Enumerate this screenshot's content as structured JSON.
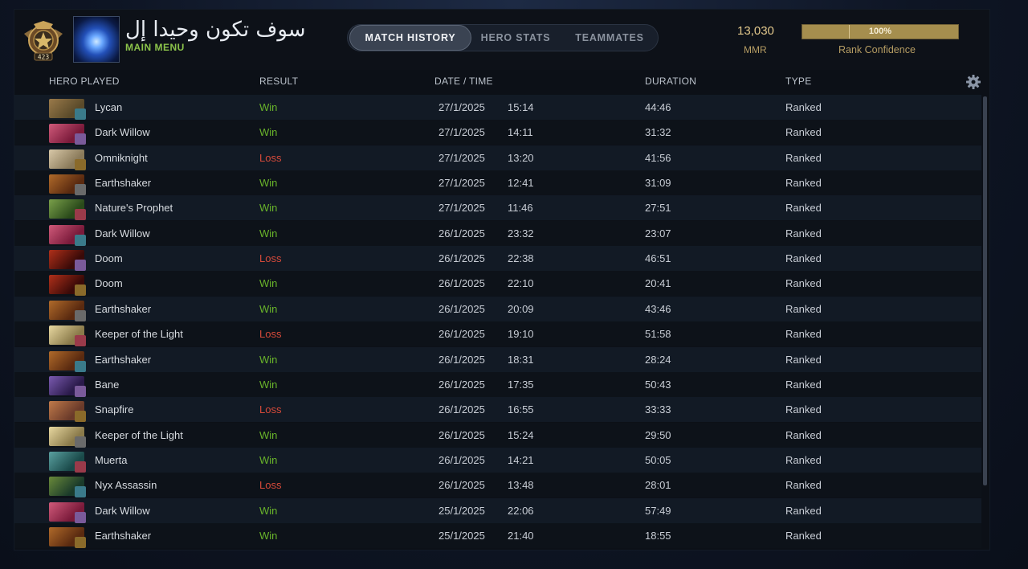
{
  "header": {
    "player_name": "سوف تكون وحيدا إل",
    "main_menu": "MAIN MENU",
    "rank_number": "423",
    "tabs": [
      {
        "label": "MATCH HISTORY",
        "active": true
      },
      {
        "label": "HERO STATS",
        "active": false
      },
      {
        "label": "TEAMMATES",
        "active": false
      }
    ],
    "mmr_value": "13,030",
    "mmr_label": "MMR",
    "rank_confidence_text": "100%",
    "rank_confidence_fraction": 1.0,
    "rank_confidence_label": "Rank Confidence"
  },
  "columns": {
    "hero": "HERO PLAYED",
    "result": "RESULT",
    "datetime": "DATE / TIME",
    "duration": "DURATION",
    "type": "TYPE"
  },
  "colors": {
    "win": "#69b42a",
    "loss": "#d64a3a",
    "gold": "#e1c78b"
  },
  "matches": [
    {
      "hero": "Lycan",
      "result": "Win",
      "date": "27/1/2025",
      "time": "15:14",
      "duration": "44:46",
      "type": "Ranked",
      "icon": "lycan-icon"
    },
    {
      "hero": "Dark Willow",
      "result": "Win",
      "date": "27/1/2025",
      "time": "14:11",
      "duration": "31:32",
      "type": "Ranked",
      "icon": "dark-willow-icon"
    },
    {
      "hero": "Omniknight",
      "result": "Loss",
      "date": "27/1/2025",
      "time": "13:20",
      "duration": "41:56",
      "type": "Ranked",
      "icon": "omniknight-icon"
    },
    {
      "hero": "Earthshaker",
      "result": "Win",
      "date": "27/1/2025",
      "time": "12:41",
      "duration": "31:09",
      "type": "Ranked",
      "icon": "earthshaker-icon"
    },
    {
      "hero": "Nature's Prophet",
      "result": "Win",
      "date": "27/1/2025",
      "time": "11:46",
      "duration": "27:51",
      "type": "Ranked",
      "icon": "natures-prophet-icon"
    },
    {
      "hero": "Dark Willow",
      "result": "Win",
      "date": "26/1/2025",
      "time": "23:32",
      "duration": "23:07",
      "type": "Ranked",
      "icon": "dark-willow-icon"
    },
    {
      "hero": "Doom",
      "result": "Loss",
      "date": "26/1/2025",
      "time": "22:38",
      "duration": "46:51",
      "type": "Ranked",
      "icon": "doom-icon"
    },
    {
      "hero": "Doom",
      "result": "Win",
      "date": "26/1/2025",
      "time": "22:10",
      "duration": "20:41",
      "type": "Ranked",
      "icon": "doom-icon"
    },
    {
      "hero": "Earthshaker",
      "result": "Win",
      "date": "26/1/2025",
      "time": "20:09",
      "duration": "43:46",
      "type": "Ranked",
      "icon": "earthshaker-icon"
    },
    {
      "hero": "Keeper of the Light",
      "result": "Loss",
      "date": "26/1/2025",
      "time": "19:10",
      "duration": "51:58",
      "type": "Ranked",
      "icon": "keeper-of-the-light-icon"
    },
    {
      "hero": "Earthshaker",
      "result": "Win",
      "date": "26/1/2025",
      "time": "18:31",
      "duration": "28:24",
      "type": "Ranked",
      "icon": "earthshaker-icon"
    },
    {
      "hero": "Bane",
      "result": "Win",
      "date": "26/1/2025",
      "time": "17:35",
      "duration": "50:43",
      "type": "Ranked",
      "icon": "bane-icon"
    },
    {
      "hero": "Snapfire",
      "result": "Loss",
      "date": "26/1/2025",
      "time": "16:55",
      "duration": "33:33",
      "type": "Ranked",
      "icon": "snapfire-icon"
    },
    {
      "hero": "Keeper of the Light",
      "result": "Win",
      "date": "26/1/2025",
      "time": "15:24",
      "duration": "29:50",
      "type": "Ranked",
      "icon": "keeper-of-the-light-icon"
    },
    {
      "hero": "Muerta",
      "result": "Win",
      "date": "26/1/2025",
      "time": "14:21",
      "duration": "50:05",
      "type": "Ranked",
      "icon": "muerta-icon"
    },
    {
      "hero": "Nyx Assassin",
      "result": "Loss",
      "date": "26/1/2025",
      "time": "13:48",
      "duration": "28:01",
      "type": "Ranked",
      "icon": "nyx-assassin-icon"
    },
    {
      "hero": "Dark Willow",
      "result": "Win",
      "date": "25/1/2025",
      "time": "22:06",
      "duration": "57:49",
      "type": "Ranked",
      "icon": "dark-willow-icon"
    },
    {
      "hero": "Earthshaker",
      "result": "Win",
      "date": "25/1/2025",
      "time": "21:40",
      "duration": "18:55",
      "type": "Ranked",
      "icon": "earthshaker-icon"
    }
  ]
}
